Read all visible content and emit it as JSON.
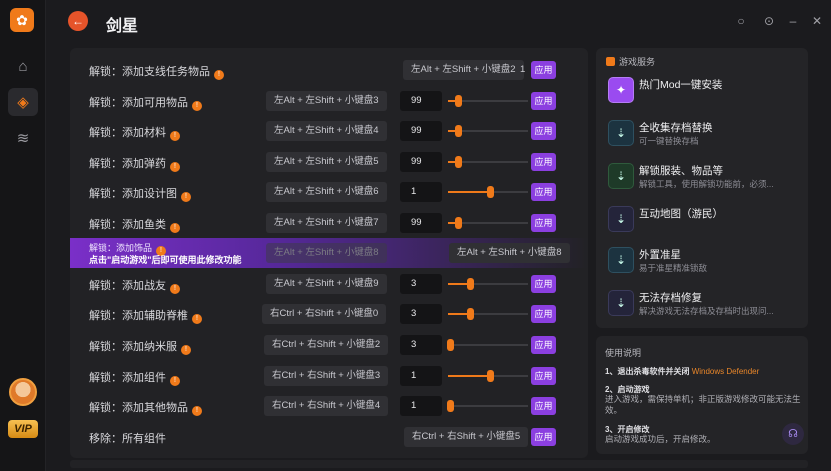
{
  "app": {
    "title": "剑星"
  },
  "sidebar": {
    "logo_icon": "app-logo-icon",
    "items": [
      {
        "name": "home",
        "icon": "home-icon",
        "glyph": "⌂"
      },
      {
        "name": "games",
        "icon": "gamepad-icon",
        "glyph": "◈"
      },
      {
        "name": "storage",
        "icon": "database-icon",
        "glyph": "≋"
      }
    ],
    "vip_label": "VIP"
  },
  "window": {
    "controls": [
      "○",
      "⊙",
      "–",
      "✕"
    ]
  },
  "mods": [
    {
      "label": "解锁：添加支线任务物品",
      "hotkey": "左Alt + 左Shift + 小键盘2",
      "count": "1",
      "apply": "应用"
    },
    {
      "label": "解锁：添加可用物品",
      "hotkey": "左Alt + 左Shift + 小键盘3",
      "value": "99",
      "slider": 0.1,
      "apply": "应用"
    },
    {
      "label": "解锁：添加材料",
      "hotkey": "左Alt + 左Shift + 小键盘4",
      "value": "99",
      "slider": 0.1,
      "apply": "应用"
    },
    {
      "label": "解锁：添加弹药",
      "hotkey": "左Alt + 左Shift + 小键盘5",
      "value": "99",
      "slider": 0.1,
      "apply": "应用"
    },
    {
      "label": "解锁：添加设计图",
      "hotkey": "左Alt + 左Shift + 小键盘6",
      "value": "1",
      "slider": 0.5,
      "apply": "应用"
    },
    {
      "label": "解锁：添加鱼类",
      "hotkey": "左Alt + 左Shift + 小键盘7",
      "value": "99",
      "slider": 0.1,
      "apply": "应用"
    },
    {
      "label": "解锁：添加战友",
      "hotkey": "左Alt + 左Shift + 小键盘9",
      "value": "3",
      "slider": 0.25,
      "apply": "应用"
    },
    {
      "label": "解锁：添加辅助脊椎",
      "hotkey": "右Ctrl + 右Shift + 小键盘0",
      "value": "3",
      "slider": 0.25,
      "apply": "应用"
    },
    {
      "label": "解锁：添加纳米服",
      "hotkey": "右Ctrl + 右Shift + 小键盘2",
      "value": "3",
      "slider": 0.0,
      "apply": "应用"
    },
    {
      "label": "解锁：添加组件",
      "hotkey": "右Ctrl + 右Shift + 小键盘3",
      "value": "1",
      "slider": 0.5,
      "apply": "应用"
    },
    {
      "label": "解锁：添加其他物品",
      "hotkey": "右Ctrl + 右Shift + 小键盘4",
      "value": "1",
      "slider": 0.0,
      "apply": "应用"
    },
    {
      "label": "移除：所有组件",
      "hotkey": "右Ctrl + 右Shift + 小键盘5",
      "apply": "应用"
    }
  ],
  "banner": {
    "label": "解锁：添加饰品",
    "notice": "点击\"启动游戏\"后即可使用此修改功能",
    "ghost_hotkey": "左Alt + 左Shift + 小键盘8",
    "hotkey": "左Alt + 左Shift + 小键盘8"
  },
  "services": {
    "title": "游戏服务",
    "items": [
      {
        "name": "热门Mod一键安装",
        "desc": "",
        "icon": "puzzle-icon"
      },
      {
        "name": "全收集存档替换",
        "desc": "可一键替换存档",
        "icon": "download-icon"
      },
      {
        "name": "解锁服装、物品等",
        "desc": "解锁工具，使用解锁功能前，必须...",
        "icon": "download-icon"
      },
      {
        "name": "互动地图（游民）",
        "desc": "",
        "icon": "download-icon"
      },
      {
        "name": "外置准星",
        "desc": "易于准星精准锁敌",
        "icon": "download-icon"
      },
      {
        "name": "无法存档修复",
        "desc": "解决游戏无法存档及存档时出现问...",
        "icon": "download-icon"
      }
    ]
  },
  "usage": {
    "title": "使用说明",
    "step1_prefix": "1、退出杀毒软件并关闭",
    "step1_highlight": "Windows Defender",
    "step2_title": "2、启动游戏",
    "step2_text": "进入游戏，需保持单机；非正版游戏修改可能无法生效。",
    "step3_title": "3、开启修改",
    "step3_text": "启动游戏成功后，开启修改。"
  },
  "colors": {
    "accent": "#f07a1a",
    "apply": "#8b3fe0",
    "banner": "#7a2fc8"
  }
}
